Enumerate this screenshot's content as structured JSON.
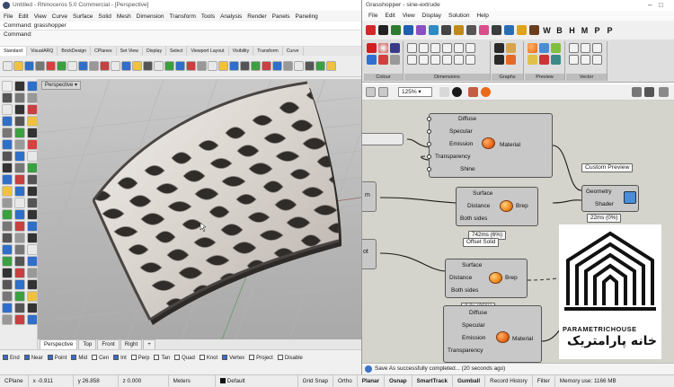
{
  "rhino": {
    "title": "Untitled - Rhinoceros 5.0 Commercial - [Perspective]",
    "menu": [
      "File",
      "Edit",
      "View",
      "Curve",
      "Surface",
      "Solid",
      "Mesh",
      "Dimension",
      "Transform",
      "Tools",
      "Analysis",
      "Render",
      "Panels",
      "Paneling"
    ],
    "command_history": "Command: grasshopper",
    "command_prompt": "Command:",
    "toolbar_tabs": [
      "Standard",
      "VisualARQ",
      "BrickDesign",
      "CPlanes",
      "Set View",
      "Display",
      "Select",
      "Viewport Layout",
      "Visibility",
      "Transform",
      "Curve"
    ],
    "viewport_title": "Perspective",
    "viewport_tabs": [
      "Perspective",
      "Top",
      "Front",
      "Right",
      "+"
    ],
    "osnaps": [
      {
        "label": "End",
        "on": true
      },
      {
        "label": "Near",
        "on": true
      },
      {
        "label": "Point",
        "on": true
      },
      {
        "label": "Mid",
        "on": true
      },
      {
        "label": "Cen",
        "on": false
      },
      {
        "label": "Int",
        "on": true
      },
      {
        "label": "Perp",
        "on": false
      },
      {
        "label": "Tan",
        "on": false
      },
      {
        "label": "Quad",
        "on": false
      },
      {
        "label": "Knot",
        "on": false
      },
      {
        "label": "Vertex",
        "on": true
      },
      {
        "label": "Project",
        "on": false
      },
      {
        "label": "Disable",
        "on": false
      }
    ]
  },
  "statusbar": {
    "cplane": "CPlane",
    "x": "x -0.911",
    "y": "y 26.858",
    "z": "z 0.000",
    "units": "Meters",
    "layer": "Default",
    "grid_snap": "Grid Snap",
    "ortho": "Ortho",
    "planar": "Planar",
    "osnap": "Osnap",
    "smarttrack": "SmartTrack",
    "gumball": "Gumball",
    "record_history": "Record History",
    "filter": "Filter",
    "memory": "Memory use: 1166 MB"
  },
  "grasshopper": {
    "title": "Grasshopper - sine-extrude",
    "menu": [
      "File",
      "Edit",
      "View",
      "Display",
      "Solution",
      "Help"
    ],
    "tab_letters": [
      "W",
      "B",
      "H",
      "M",
      "P",
      "P"
    ],
    "ribbon_groups": [
      "Colour",
      "Dimensions",
      "Graphs",
      "Preview",
      "Vector"
    ],
    "zoom": "125%",
    "status": "Save As successfully completed... (20 seconds ago)",
    "components": {
      "shader1_rows": [
        "Diffuse",
        "Specular",
        "Emission",
        "Transparency",
        "Shine"
      ],
      "shader1_output": "Material",
      "offset1_inputs": [
        "Surface",
        "Distance",
        "Both sides"
      ],
      "offset1_output": "Brep",
      "offset1_timing": "742ms (6%)",
      "offset2_label": "Offset Solid",
      "offset2_inputs": [
        "Surface",
        "Distance",
        "Both sides"
      ],
      "offset2_output": "Brep",
      "offset2_timing": "2.8s (26%)",
      "shader2_rows": [
        "Diffuse",
        "Specular",
        "Emission",
        "Transparency"
      ],
      "shader2_output": "Material",
      "preview_title": "Custom Preview",
      "preview_inputs": [
        "Geometry",
        "Shader"
      ],
      "preview_timing": "22ms (0%)",
      "left_stub_labels": [
        "m",
        "ot"
      ]
    }
  },
  "watermark": {
    "brand_en": "PARAMETRICHOUSE",
    "brand_fa": "خانه پارامتریک"
  },
  "colors": {
    "gh_canvas": "#d4d4cc",
    "rhino_viewport": "#bdbdbd",
    "accent_orange": "#e86a1a"
  }
}
